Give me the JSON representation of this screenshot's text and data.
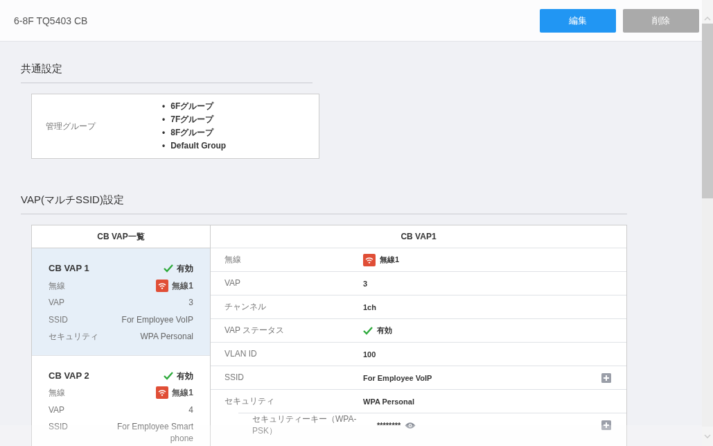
{
  "header": {
    "title": "6-8F TQ5403 CB",
    "buttons": [
      {
        "label": "編集",
        "kind": "primary"
      },
      {
        "label": "削除",
        "kind": "secondary"
      }
    ]
  },
  "common": {
    "heading": "共通設定",
    "label": "管理グループ",
    "groups": [
      {
        "bullet": "•",
        "label": "6Fグループ"
      },
      {
        "bullet": "•",
        "label": "7Fグループ"
      },
      {
        "bullet": "•",
        "label": "8Fグループ"
      },
      {
        "bullet": "•",
        "label": "Default Group"
      }
    ]
  },
  "vap": {
    "heading": "VAP(マルチSSID)設定",
    "list_heading": "CB VAP一覧",
    "cards": [
      {
        "title": "CB VAP 1",
        "status": "有効",
        "enabled": true,
        "selected": true,
        "fields": [
          {
            "kind": "radio",
            "label": "無線",
            "value": "無線1"
          },
          {
            "kind": "text",
            "label": "VAP",
            "value": "3"
          },
          {
            "kind": "text",
            "label": "SSID",
            "value": "For Employee VoIP"
          },
          {
            "kind": "text",
            "label": "セキュリティ",
            "value": "WPA Personal"
          }
        ]
      },
      {
        "title": "CB VAP 2",
        "status": "有効",
        "enabled": true,
        "selected": false,
        "fields": [
          {
            "kind": "radio",
            "label": "無線",
            "value": "無線1"
          },
          {
            "kind": "text",
            "label": "VAP",
            "value": "4"
          },
          {
            "kind": "text",
            "label": "SSID",
            "value": "For Employee Smart phone"
          }
        ]
      }
    ],
    "detail_heading": "CB VAP1",
    "details": [
      {
        "kind": "radio",
        "label": "無線",
        "value": "無線1"
      },
      {
        "kind": "text",
        "label": "VAP",
        "value": "3"
      },
      {
        "kind": "text",
        "label": "チャンネル",
        "value": "1ch"
      },
      {
        "kind": "status",
        "label": "VAP ステータス",
        "value": "有効",
        "enabled": true
      },
      {
        "kind": "text",
        "label": "VLAN ID",
        "value": "100"
      },
      {
        "kind": "text",
        "label": "SSID",
        "value": "For Employee VoIP",
        "expandable": true
      },
      {
        "kind": "text",
        "label": "セキュリティ",
        "value": "WPA Personal"
      },
      {
        "kind": "secret",
        "label": "セキュリティーキー（WPA-PSK）",
        "value": "********",
        "expandable": true
      }
    ]
  }
}
